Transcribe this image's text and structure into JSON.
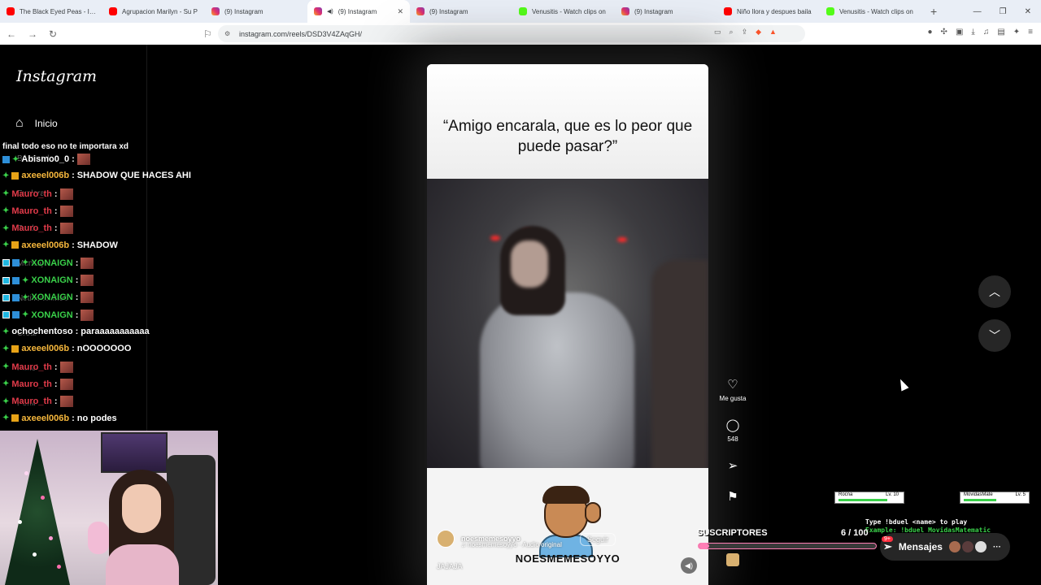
{
  "browser": {
    "tabs": [
      {
        "title": "The Black Eyed Peas - I Go",
        "icon": "youtube-icon",
        "active": false
      },
      {
        "title": "Agrupacion Marilyn - Su P",
        "icon": "youtube-icon",
        "active": false
      },
      {
        "title": "(9) Instagram",
        "icon": "instagram-icon",
        "active": false
      },
      {
        "title": "(9) Instagram",
        "icon": "instagram-icon",
        "active": true
      },
      {
        "title": "(9) Instagram",
        "icon": "instagram-icon",
        "active": false
      },
      {
        "title": "Venusitis - Watch clips on",
        "icon": "kick-icon",
        "active": false
      },
      {
        "title": "(9) Instagram",
        "icon": "instagram-icon",
        "active": false
      },
      {
        "title": "Niño llora y despues baila",
        "icon": "youtube-icon",
        "active": false
      },
      {
        "title": "Venusitis - Watch clips on",
        "icon": "kick-icon",
        "active": false
      }
    ],
    "url": "instagram.com/reels/DSD3V4ZAqGH/",
    "shield_badge": "2"
  },
  "instagram": {
    "logo": "Instagram",
    "nav_home": "Inicio",
    "nav_ghost": [
      "Búsqueda",
      "Explorar",
      "Reels",
      "Mensajes",
      "Notificaciones",
      "Crear",
      "Panel",
      "Perfil"
    ]
  },
  "chat": {
    "top_fragment": "final todo eso no te importara xd",
    "messages": [
      {
        "user": "Abismo0_0",
        "color": "#ffffff",
        "text": "",
        "badges": [
          "blue",
          "green"
        ],
        "emote": true
      },
      {
        "user": "axeeel006b",
        "color": "#f6b73c",
        "text": "SHADOW QUE HACES AHI",
        "badges": [
          "green",
          "gold"
        ],
        "emote": false
      },
      {
        "user": "Mauro_th",
        "color": "#e23b4a",
        "text": "",
        "badges": [
          "green"
        ],
        "emote": true
      },
      {
        "user": "Mauro_th",
        "color": "#e23b4a",
        "text": "",
        "badges": [
          "green"
        ],
        "emote": true
      },
      {
        "user": "Mauro_th",
        "color": "#e23b4a",
        "text": "",
        "badges": [
          "green"
        ],
        "emote": true
      },
      {
        "user": "axeeel006b",
        "color": "#f6b73c",
        "text": "SHADOW",
        "badges": [
          "green",
          "gold"
        ],
        "emote": false
      },
      {
        "user": "XONAIGN",
        "color": "#3ad14a",
        "text": "",
        "badges": [
          "cyan",
          "blue",
          "green"
        ],
        "emote": true
      },
      {
        "user": "XONAIGN",
        "color": "#3ad14a",
        "text": "",
        "badges": [
          "cyan",
          "blue",
          "green"
        ],
        "emote": true
      },
      {
        "user": "XONAIGN",
        "color": "#3ad14a",
        "text": "",
        "badges": [
          "cyan",
          "blue",
          "green"
        ],
        "emote": true
      },
      {
        "user": "XONAIGN",
        "color": "#3ad14a",
        "text": "",
        "badges": [
          "cyan",
          "blue",
          "green"
        ],
        "emote": true
      },
      {
        "user": "ochochentoso",
        "color": "#ffffff",
        "text": "paraaaaaaaaaaa",
        "badges": [
          "green"
        ],
        "emote": false
      },
      {
        "user": "axeeel006b",
        "color": "#f6b73c",
        "text": "nOOOOOOO",
        "badges": [
          "green",
          "gold"
        ],
        "emote": false
      },
      {
        "user": "Mauro_th",
        "color": "#e23b4a",
        "text": "",
        "badges": [
          "green"
        ],
        "emote": true
      },
      {
        "user": "Mauro_th",
        "color": "#e23b4a",
        "text": "",
        "badges": [
          "green"
        ],
        "emote": true
      },
      {
        "user": "Mauro_th",
        "color": "#e23b4a",
        "text": "",
        "badges": [
          "green"
        ],
        "emote": true
      },
      {
        "user": "axeeel006b",
        "color": "#f6b73c",
        "text": "no podes",
        "badges": [
          "green",
          "gold"
        ],
        "emote": false
      }
    ]
  },
  "reel": {
    "caption": "“Amigo encarala, que es lo peor que puede pasar?”",
    "author": "noesmemesoyyo",
    "audio": "noesmemesoyyo · Audio original",
    "follow": "Seguir",
    "description": "JAJAJA",
    "brand": "NOESMEMESOYYO"
  },
  "actions": {
    "like_label": "Me gusta",
    "comments_count": "548"
  },
  "overlay": {
    "subs_label": "SUSCRIPTORES",
    "subs_count": "6 / 100",
    "subs_progress": 0.06,
    "duel_left": "Rocna",
    "duel_left_lv": "Lv. 10",
    "duel_right": "MovidasMate",
    "duel_right_lv": "Lv. 5",
    "duel_hint": "Type !bduel <name> to play",
    "duel_example": "Example: !bduel MovidasMatematic",
    "messages_label": "Mensajes",
    "messages_badge": "9+"
  }
}
